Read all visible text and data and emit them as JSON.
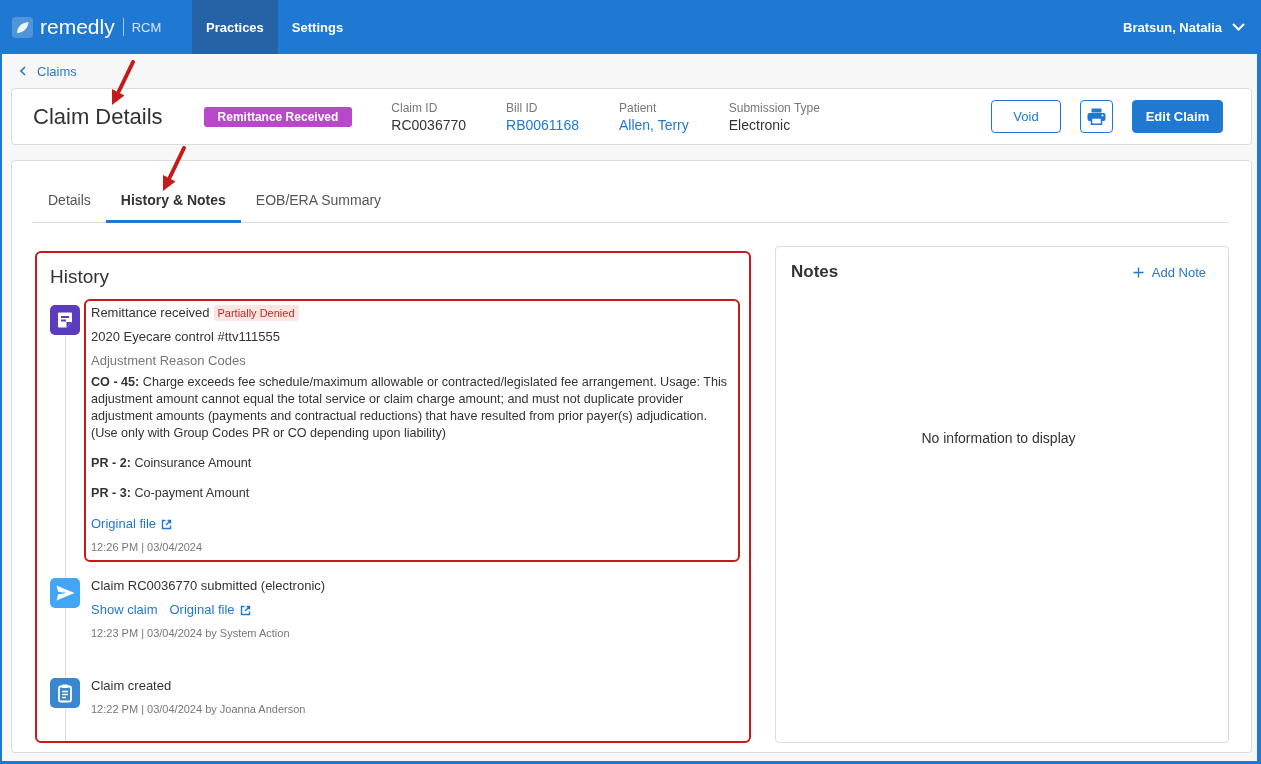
{
  "top_bar": {
    "logo": {
      "brand": "remedly",
      "product": "RCM"
    },
    "nav": [
      {
        "label": "Practices",
        "selected": true
      },
      {
        "label": "Settings",
        "selected": false
      }
    ],
    "user": {
      "name": "Bratsun, Natalia"
    }
  },
  "breadcrumb": {
    "label": "Claims"
  },
  "header": {
    "title": "Claim Details",
    "title_arrow": true,
    "status": "Remittance Received",
    "fields": [
      {
        "label": "Claim ID",
        "value": "RC0036770",
        "kind": "text"
      },
      {
        "label": "Bill ID",
        "value": "RB0061168",
        "kind": "link"
      },
      {
        "label": "Patient",
        "value": "Allen, Terry",
        "kind": "link"
      },
      {
        "label": "Submission Type",
        "value": "Electronic",
        "kind": "text"
      }
    ],
    "buttons": [
      {
        "kind": "outline",
        "label": "Void"
      },
      {
        "kind": "print"
      },
      {
        "kind": "primary",
        "label": "Edit Claim"
      }
    ]
  },
  "tabs": [
    {
      "label": "Details",
      "selected": false,
      "arrow": false
    },
    {
      "label": "History & Notes",
      "selected": true,
      "arrow": true
    },
    {
      "label": "EOB/ERA Summary",
      "selected": false,
      "arrow": false
    }
  ],
  "history": {
    "title": "History",
    "highlighted": true,
    "events": [
      {
        "kind": "remittance",
        "highlighted": true,
        "title": "Remittance received",
        "tag": "Partially Denied",
        "subtitle": "2020 Eyecare control #ttv111555",
        "codes_heading": "Adjustment Reason Codes",
        "codes": [
          "**CO - 45:** Charge exceeds fee schedule/maximum allowable or contracted/legislated fee arrangement. Usage: This adjustment amount cannot equal the total service or claim charge amount; and must not duplicate provider adjustment amounts (payments and contractual reductions) that have resulted from prior payer(s) adjudication. (Use only with Group Codes PR or CO depending upon liability)",
          "**PR - 2:** Coinsurance Amount",
          "**PR - 3:** Co-payment Amount"
        ],
        "links": [
          {
            "label": "Original file",
            "external": true
          }
        ],
        "time": "12:26 PM | 03/04/2024"
      },
      {
        "kind": "submitted",
        "highlighted": false,
        "title": "Claim RC0036770 submitted (electronic)",
        "links": [
          {
            "label": "Show claim",
            "external": false
          },
          {
            "label": "Original file",
            "external": true
          }
        ],
        "time": "12:23 PM | 03/04/2024 by System Action"
      },
      {
        "kind": "created",
        "highlighted": false,
        "title": "Claim created",
        "time": "12:22 PM | 03/04/2024 by Joanna Anderson"
      }
    ]
  },
  "notes": {
    "title": "Notes",
    "add_button": "Add Note",
    "empty_text": "No information to display"
  }
}
